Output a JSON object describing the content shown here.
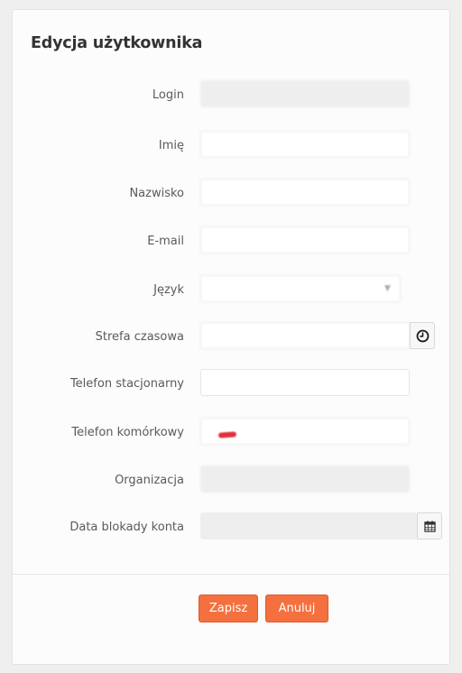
{
  "form": {
    "title": "Edycja użytkownika",
    "fields": {
      "login": {
        "label": "Login",
        "value": ""
      },
      "first_name": {
        "label": "Imię",
        "value": ""
      },
      "last_name": {
        "label": "Nazwisko",
        "value": ""
      },
      "email": {
        "label": "E-mail",
        "value": ""
      },
      "language": {
        "label": "Język",
        "value": ""
      },
      "timezone": {
        "label": "Strefa czasowa",
        "value": ""
      },
      "landline": {
        "label": "Telefon stacjonarny",
        "value": ""
      },
      "mobile": {
        "label": "Telefon komórkowy",
        "value": ""
      },
      "organization": {
        "label": "Organizacja",
        "value": ""
      },
      "lock_date": {
        "label": "Data blokady konta",
        "value": ""
      }
    },
    "buttons": {
      "save": "Zapisz",
      "cancel": "Anuluj"
    }
  },
  "icons": {
    "timezone_addon": "clock-icon",
    "lock_date_addon": "calendar-icon",
    "language_dropdown": "chevron-down-icon"
  },
  "colors": {
    "accent": "#f4703f",
    "accent_border": "#e05a2e",
    "disabled_field": "#eeeeee",
    "redaction_mark": "#e0303c"
  }
}
